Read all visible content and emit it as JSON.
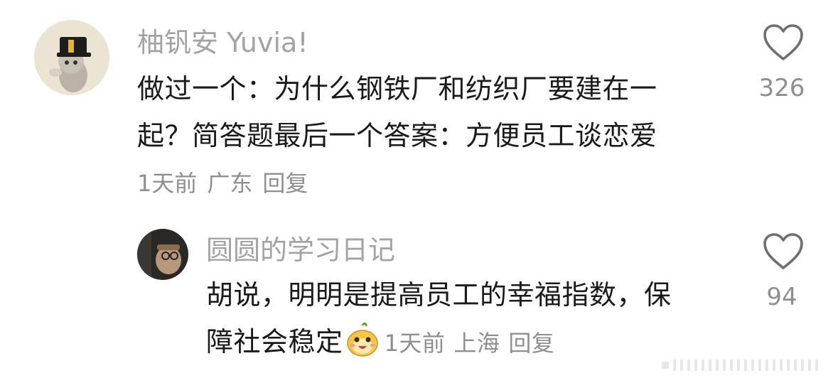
{
  "comment": {
    "username": "柚钒安 Yuvia!",
    "text_line1": "做过一个：为什么钢铁厂和纺织厂要建在一",
    "text_line2": "起？简答题最后一个答案：方便员工谈恋爱",
    "time": "1天前",
    "location": "广东",
    "reply_label": "回复",
    "like_count": "326"
  },
  "reply": {
    "username": "圆圆的学习日记",
    "text_line1": "胡说，明明是提高员工的幸福指数，保",
    "text_line2": "障社会稳定",
    "time": "1天前",
    "location": "上海",
    "reply_label": "回复",
    "like_count": "94"
  },
  "icons": {
    "like": "heart-outline-icon",
    "emoji": "happy-face-sticker"
  },
  "colors": {
    "username": "#a3a3a3",
    "text": "#1a1a1a",
    "meta": "#8f8f8f"
  }
}
